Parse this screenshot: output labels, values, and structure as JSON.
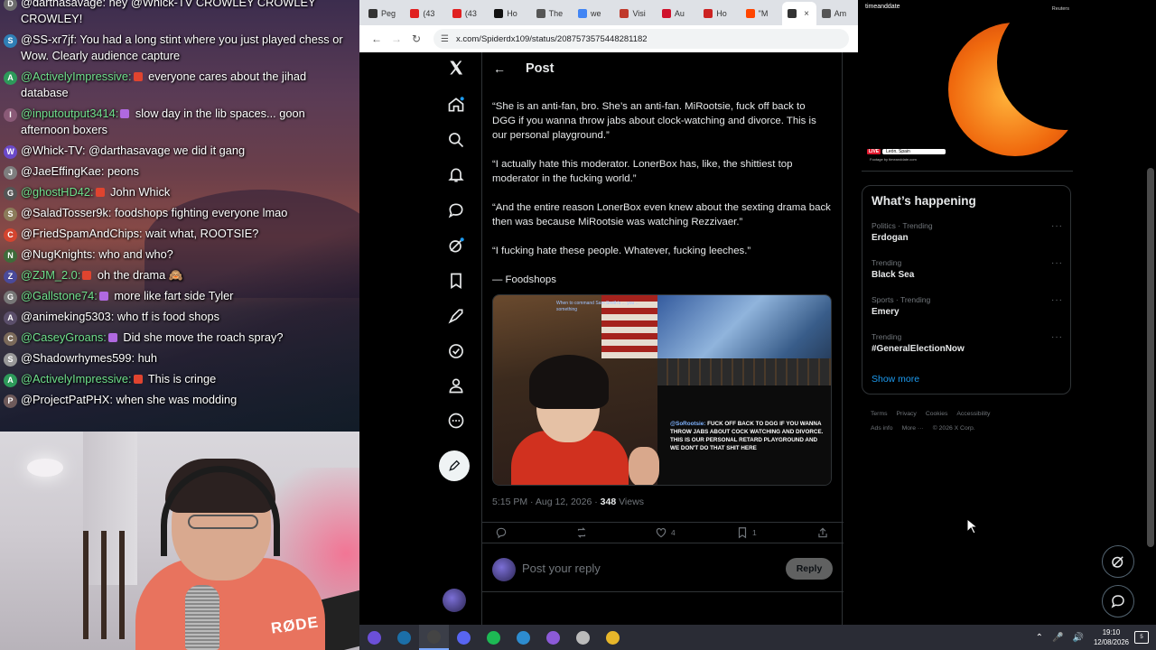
{
  "chat": {
    "messages": [
      {
        "user": "@darthasavage:",
        "text": " hey @Whick-TV CROWLEY CROWLEY CROWLEY!",
        "avatar": "D",
        "color": "#ffffff",
        "avbg": "#6d6d6d",
        "badge": "",
        "two": true
      },
      {
        "user": "@SS-xr7jf:",
        "text": " You had a long stint where you just played chess or Wow. Clearly audience capture",
        "avatar": "S",
        "color": "#ffffff",
        "avbg": "#2f7fb6",
        "badge": "",
        "two": true
      },
      {
        "user": "@ActivelyImpressive:",
        "text": " everyone cares about the jihad database",
        "avatar": "A",
        "color": "#6fe08c",
        "avbg": "#2d9a5a",
        "badge": "#e0442f",
        "two": true
      },
      {
        "user": "@inputoutput3414:",
        "text": " slow day in the lib spaces... goon afternoon boxers",
        "avatar": "I",
        "color": "#6fe08c",
        "avbg": "#8a5a77",
        "badge": "#b069e0",
        "two": true
      },
      {
        "user": "@Whick-TV:",
        "text": " @darthasavage we did it gang",
        "avatar": "W",
        "color": "#ffffff",
        "avbg": "#6b49c9",
        "badge": "",
        "two": false
      },
      {
        "user": "@JaeEffingKae:",
        "text": " peons",
        "avatar": "J",
        "color": "#ffffff",
        "avbg": "#7e7e7e",
        "badge": "",
        "two": false
      },
      {
        "user": "@ghostHD42:",
        "text": " John Whick",
        "avatar": "G",
        "color": "#6fe08c",
        "avbg": "#555555",
        "badge": "#e0442f",
        "two": false
      },
      {
        "user": "@SaladTosser9k:",
        "text": " foodshops fighting everyone lmao",
        "avatar": "S",
        "color": "#ffffff",
        "avbg": "#8b7b5a",
        "badge": "",
        "two": false
      },
      {
        "user": "@FriedSpamAndChips:",
        "text": " wait what, ROOTSIE?",
        "avatar": "C",
        "color": "#ffffff",
        "avbg": "#d4442f",
        "badge": "",
        "two": false
      },
      {
        "user": "@NugKnights:",
        "text": " who and who?",
        "avatar": "N",
        "color": "#ffffff",
        "avbg": "#3f6b3a",
        "badge": "",
        "two": false
      },
      {
        "user": "@ZJM_2.0:",
        "text": " oh the drama 🙈",
        "avatar": "Z",
        "color": "#6fe08c",
        "avbg": "#4a4a9a",
        "badge": "#e0442f",
        "two": false
      },
      {
        "user": "@Gallstone74:",
        "text": " more like fart side Tyler",
        "avatar": "G",
        "color": "#6fe08c",
        "avbg": "#777777",
        "badge": "#b069e0",
        "two": false
      },
      {
        "user": "@animeking5303:",
        "text": " who tf is food shops",
        "avatar": "A",
        "color": "#ffffff",
        "avbg": "#5b4f6b",
        "badge": "",
        "two": false
      },
      {
        "user": "@CaseyGroans:",
        "text": " Did she move the roach spray?",
        "avatar": "C",
        "color": "#6fe08c",
        "avbg": "#7b6a5a",
        "badge": "#b069e0",
        "two": false
      },
      {
        "user": "@Shadowrhymes599:",
        "text": " huh",
        "avatar": "S",
        "color": "#ffffff",
        "avbg": "#999999",
        "badge": "",
        "two": false
      },
      {
        "user": "@ActivelyImpressive:",
        "text": " This is cringe",
        "avatar": "A",
        "color": "#6fe08c",
        "avbg": "#2d9a5a",
        "badge": "#e0442f",
        "two": false
      },
      {
        "user": "@ProjectPatPHX:",
        "text": " when she was modding",
        "avatar": "P",
        "color": "#ffffff",
        "avbg": "#6e5a5a",
        "badge": "",
        "two": false
      }
    ]
  },
  "webcam": {
    "mic_brand": "RØDE"
  },
  "browser": {
    "tabs": [
      {
        "label": "Peg",
        "fav": "#333333"
      },
      {
        "label": "(43",
        "fav": "#e02020"
      },
      {
        "label": "(43",
        "fav": "#e02020"
      },
      {
        "label": "Ho",
        "fav": "#111111"
      },
      {
        "label": "The",
        "fav": "#555555"
      },
      {
        "label": "we",
        "fav": "#4285f4"
      },
      {
        "label": "Visi",
        "fav": "#c0392b"
      },
      {
        "label": "Au",
        "fav": "#d0112b"
      },
      {
        "label": "Ho",
        "fav": "#cc2222"
      },
      {
        "label": "\"M",
        "fav": "#ff4500"
      },
      {
        "label": "",
        "fav": "#333333",
        "active": true
      },
      {
        "label": "Am",
        "fav": "#555555"
      }
    ],
    "url": "x.com/Spiderdx109/status/2087573575448281182"
  },
  "post": {
    "header_title": "Post",
    "paragraphs": [
      "“She is an anti-fan, bro. She’s an anti-fan. MiRootsie, fuck off back to DGG if you wanna throw jabs about clock-watching and divorce. This is our personal playground.”",
      "“I actually hate this moderator. LonerBox has, like, the shittiest top moderator in the fucking world.”",
      "“And the entire reason LonerBox even knew about the sexting drama back then was because MiRootsie was watching Rezzivaer.”",
      "“I fucking hate these people. Whatever, fucking leeches.”",
      "— Foodshops"
    ],
    "image_caption_user": "@SoRootsie:",
    "image_caption_text": " FUCK OFF BACK TO DGG IF YOU WANNA THROW JABS ABOUT COCK WATCHING AND DIVORCE. THIS IS OUR PERSONAL RETARD PLAYGROUND AND WE DON'T DO THAT SHIT HERE",
    "image_top_caption": "When to command Sam Smith's ... you ... something",
    "timestamp": "5:15 PM · Aug 12, 2026 · ",
    "views_count": "348",
    "views_label": " Views",
    "likes": "4",
    "bookmarks": "1",
    "reply_placeholder": "Post your reply",
    "reply_button": "Reply"
  },
  "video": {
    "logo": "timeanddate",
    "source": "Reuters",
    "live": "LIVE",
    "location": "León, Spain",
    "footer": "Footage by timeanddate.com"
  },
  "trends": {
    "title": "What’s happening",
    "items": [
      {
        "meta": "Politics · Trending",
        "name": "Erdogan"
      },
      {
        "meta": "Trending",
        "name": "Black Sea"
      },
      {
        "meta": "Sports · Trending",
        "name": "Emery"
      },
      {
        "meta": "Trending",
        "name": "#GeneralElectionNow"
      }
    ],
    "show_more": "Show more"
  },
  "footer_links": {
    "terms": "Terms",
    "privacy": "Privacy",
    "cookies": "Cookies",
    "accessibility": "Accessibility",
    "ads": "Ads info",
    "more": "More ···",
    "copyright": "© 2026 X Corp."
  },
  "taskbar": {
    "icons": [
      {
        "name": "arc-icon",
        "color": "#6b4fd8"
      },
      {
        "name": "steam-icon",
        "color": "#1b6fa8"
      },
      {
        "name": "obs-icon",
        "color": "#444444",
        "active": true
      },
      {
        "name": "discord-icon",
        "color": "#5865f2"
      },
      {
        "name": "spotify-icon",
        "color": "#1db954"
      },
      {
        "name": "streamlabs-icon",
        "color": "#2d8ccf"
      },
      {
        "name": "fl-icon",
        "color": "#8c5ad8"
      },
      {
        "name": "settings-icon",
        "color": "#bbbbbb"
      },
      {
        "name": "chrome-icon",
        "color": "#e7b62a"
      }
    ],
    "time": "19:10",
    "date": "12/08/2026",
    "notifications": "5"
  },
  "colors": {
    "accent": "#1d9bf0",
    "x_bg": "#000000",
    "text": "#e7e9ea",
    "muted": "#71767b"
  }
}
